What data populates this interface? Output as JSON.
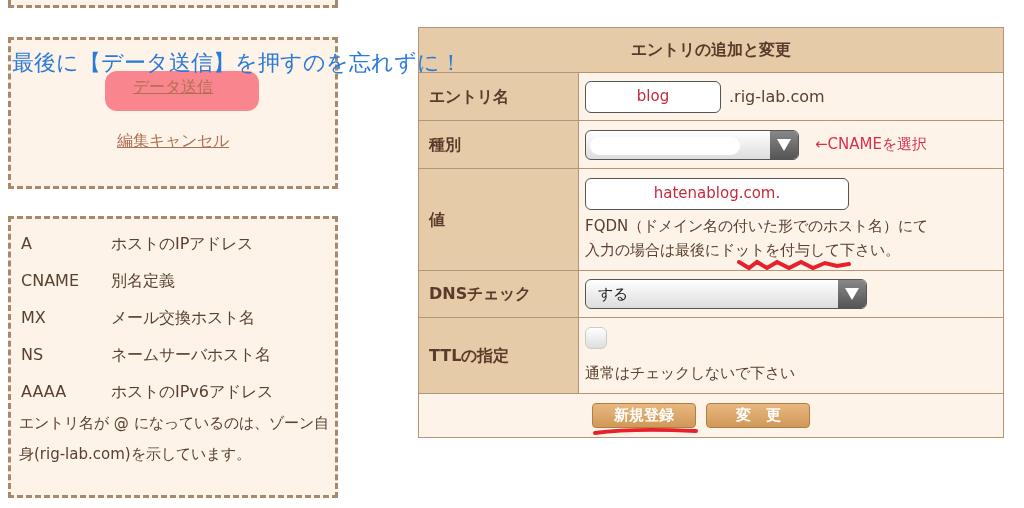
{
  "annotation": "最後に【データ送信】を押すのを忘れずに！",
  "actions_box": {
    "links": [
      {
        "label": "データ送信",
        "highlighted": true
      },
      {
        "label": "編集キャンセル",
        "highlighted": false
      }
    ]
  },
  "legend": {
    "rows": [
      {
        "type": "A",
        "description": "ホストのIPアドレス"
      },
      {
        "type": "CNAME",
        "description": "別名定義"
      },
      {
        "type": "MX",
        "description": "メール交換ホスト名"
      },
      {
        "type": "NS",
        "description": "ネームサーバホスト名"
      },
      {
        "type": "AAAA",
        "description": "ホストのIPv6アドレス"
      }
    ],
    "note": "エントリ名が @ になっているのは、ゾーン自身(rig-lab.com)を示しています。"
  },
  "form": {
    "title": "エントリの追加と変更",
    "rows": [
      {
        "kind": "text",
        "label": "エントリ名",
        "value": "blog",
        "suffix": ".rig-lab.com"
      },
      {
        "kind": "select",
        "label": "種別",
        "redacted": true,
        "annotation": "←CNAMEを選択"
      },
      {
        "kind": "wide_text",
        "label": "値",
        "value": "hatenablog.com.",
        "help": [
          {
            "text": "FQDN（ドメイン名の付いた形でのホスト名）にて",
            "marked": false
          },
          {
            "text": "入力の場合は最後にドットを付与して下さい。",
            "marked": true
          }
        ]
      },
      {
        "kind": "select",
        "label": "DNSチェック",
        "value": "する",
        "redacted": false
      },
      {
        "kind": "checkbox",
        "label": "TTLの指定",
        "checked": false,
        "help": [
          {
            "text": "通常はチェックしないで下さい",
            "marked": false
          }
        ]
      }
    ],
    "buttons": [
      {
        "label": "新規登録",
        "underlined": true
      },
      {
        "label": "変　更",
        "underlined": false
      }
    ]
  }
}
